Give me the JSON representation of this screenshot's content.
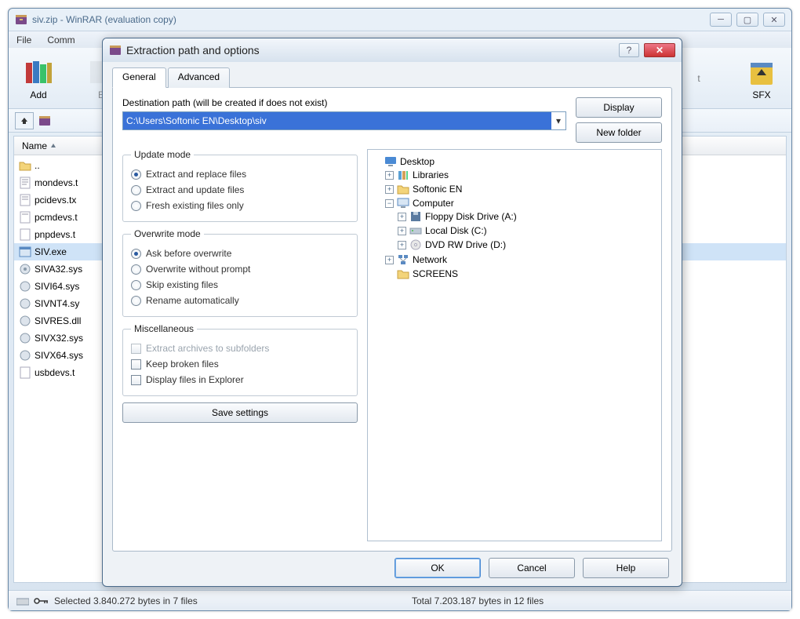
{
  "main": {
    "title": "siv.zip - WinRAR (evaluation copy)",
    "menus": [
      "File",
      "Comm"
    ],
    "toolbar": {
      "add": "Add",
      "right1": "t",
      "sfx": "SFX"
    },
    "col_name": "Name",
    "files": [
      "..",
      "mondevs.t",
      "pcidevs.tx",
      "pcmdevs.t",
      "pnpdevs.t",
      "SIV.exe",
      "SIVA32.sys",
      "SIVI64.sys",
      "SIVNT4.sy",
      "SIVRES.dll",
      "SIVX32.sys",
      "SIVX64.sys",
      "usbdevs.t"
    ],
    "status_left": "Selected 3.840.272 bytes in 7 files",
    "status_right": "Total 7.203.187 bytes in 12 files"
  },
  "dialog": {
    "title": "Extraction path and options",
    "tabs": {
      "general": "General",
      "advanced": "Advanced"
    },
    "dest_label": "Destination path (will be created if does not exist)",
    "dest_path": "C:\\Users\\Softonic EN\\Desktop\\siv",
    "btn_display": "Display",
    "btn_newfolder": "New folder",
    "update_mode": {
      "legend": "Update mode",
      "opt1": "Extract and replace files",
      "opt2": "Extract and update files",
      "opt3": "Fresh existing files only"
    },
    "overwrite_mode": {
      "legend": "Overwrite mode",
      "opt1": "Ask before overwrite",
      "opt2": "Overwrite without prompt",
      "opt3": "Skip existing files",
      "opt4": "Rename automatically"
    },
    "misc": {
      "legend": "Miscellaneous",
      "opt1": "Extract archives to subfolders",
      "opt2": "Keep broken files",
      "opt3": "Display files in Explorer"
    },
    "save_settings": "Save settings",
    "tree": {
      "desktop": "Desktop",
      "libraries": "Libraries",
      "softonic": "Softonic EN",
      "computer": "Computer",
      "floppy": "Floppy Disk Drive (A:)",
      "localdisk": "Local Disk (C:)",
      "dvd": "DVD RW Drive (D:)",
      "network": "Network",
      "screens": "SCREENS"
    },
    "ok": "OK",
    "cancel": "Cancel",
    "help": "Help"
  }
}
